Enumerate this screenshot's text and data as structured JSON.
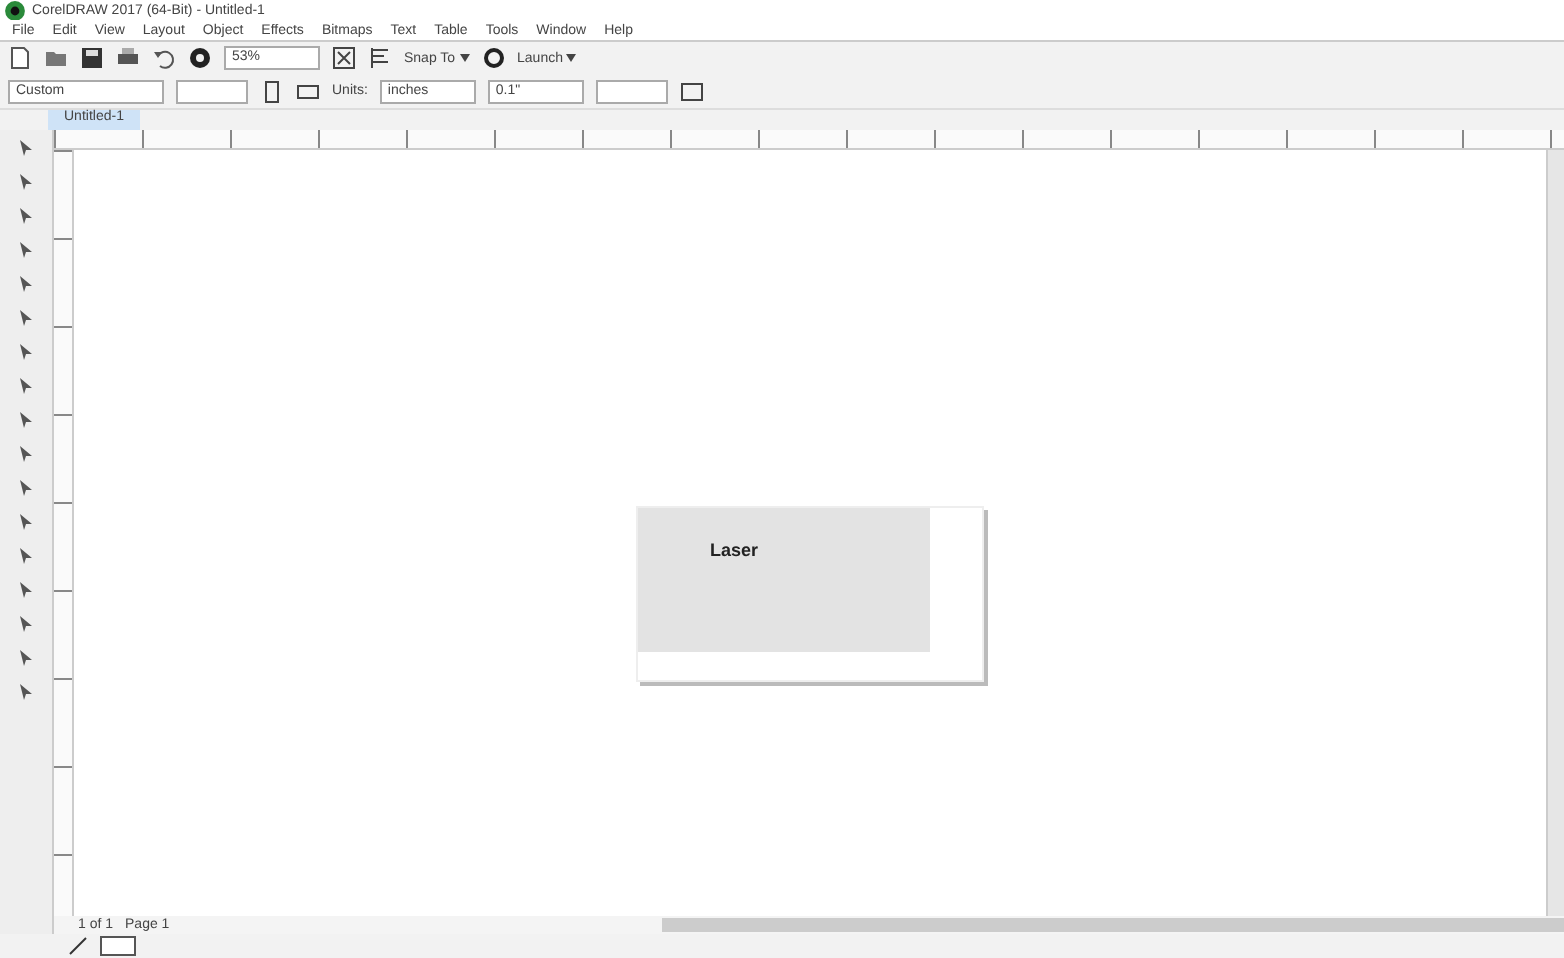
{
  "window": {
    "title": "CorelDRAW 2017 (64-Bit) - Untitled-1"
  },
  "menu": [
    "File",
    "Edit",
    "View",
    "Layout",
    "Object",
    "Effects",
    "Bitmaps",
    "Text",
    "Table",
    "Tools",
    "Window",
    "Help"
  ],
  "toolbar": {
    "zoom": "53%",
    "snap": "Snap To",
    "launch": "Launch"
  },
  "property_bar": {
    "page_size": "Custom",
    "units_label": "Units:",
    "units": "inches",
    "nudge": "0.1\""
  },
  "document_tabs": [
    {
      "label": "Untitled-1",
      "selected": true
    }
  ],
  "canvas": {
    "label": "Laser"
  },
  "page_nav": {
    "pages": "1 of 1",
    "tab": "Page 1"
  }
}
